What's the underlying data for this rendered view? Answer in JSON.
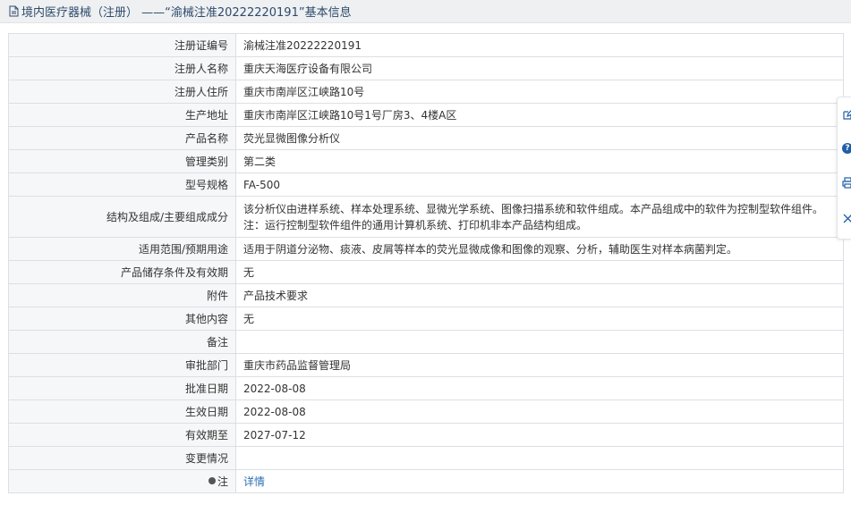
{
  "header": {
    "icon": "document-icon",
    "title": "境内医疗器械（注册） ——“渝械注准20222220191”基本信息"
  },
  "rows": [
    {
      "label": "注册证编号",
      "value": "渝械注准20222220191"
    },
    {
      "label": "注册人名称",
      "value": "重庆天海医疗设备有限公司"
    },
    {
      "label": "注册人住所",
      "value": "重庆市南岸区江峡路10号"
    },
    {
      "label": "生产地址",
      "value": "重庆市南岸区江峡路10号1号厂房3、4楼A区"
    },
    {
      "label": "产品名称",
      "value": "荧光显微图像分析仪"
    },
    {
      "label": "管理类别",
      "value": "第二类"
    },
    {
      "label": "型号规格",
      "value": "FA-500"
    },
    {
      "label": "结构及组成/主要组成成分",
      "value": "该分析仪由进样系统、样本处理系统、显微光学系统、图像扫描系统和软件组成。本产品组成中的软件为控制型软件组件。注：运行控制型软件组件的通用计算机系统、打印机非本产品结构组成。"
    },
    {
      "label": "适用范围/预期用途",
      "value": "适用于阴道分泌物、痰液、皮屑等样本的荧光显微成像和图像的观察、分析，辅助医生对样本病菌判定。"
    },
    {
      "label": "产品储存条件及有效期",
      "value": "无"
    },
    {
      "label": "附件",
      "value": "产品技术要求"
    },
    {
      "label": "其他内容",
      "value": "无"
    },
    {
      "label": "备注",
      "value": ""
    },
    {
      "label": "审批部门",
      "value": "重庆市药品监督管理局"
    },
    {
      "label": "批准日期",
      "value": "2022-08-08"
    },
    {
      "label": "生效日期",
      "value": "2022-08-08"
    },
    {
      "label": "有效期至",
      "value": "2027-07-12"
    },
    {
      "label": "变更情况",
      "value": ""
    },
    {
      "label": "注",
      "value": "详情"
    }
  ],
  "side_tools": [
    "edit-icon",
    "help-icon",
    "print-icon",
    "close-icon"
  ],
  "help_glyph": "?"
}
